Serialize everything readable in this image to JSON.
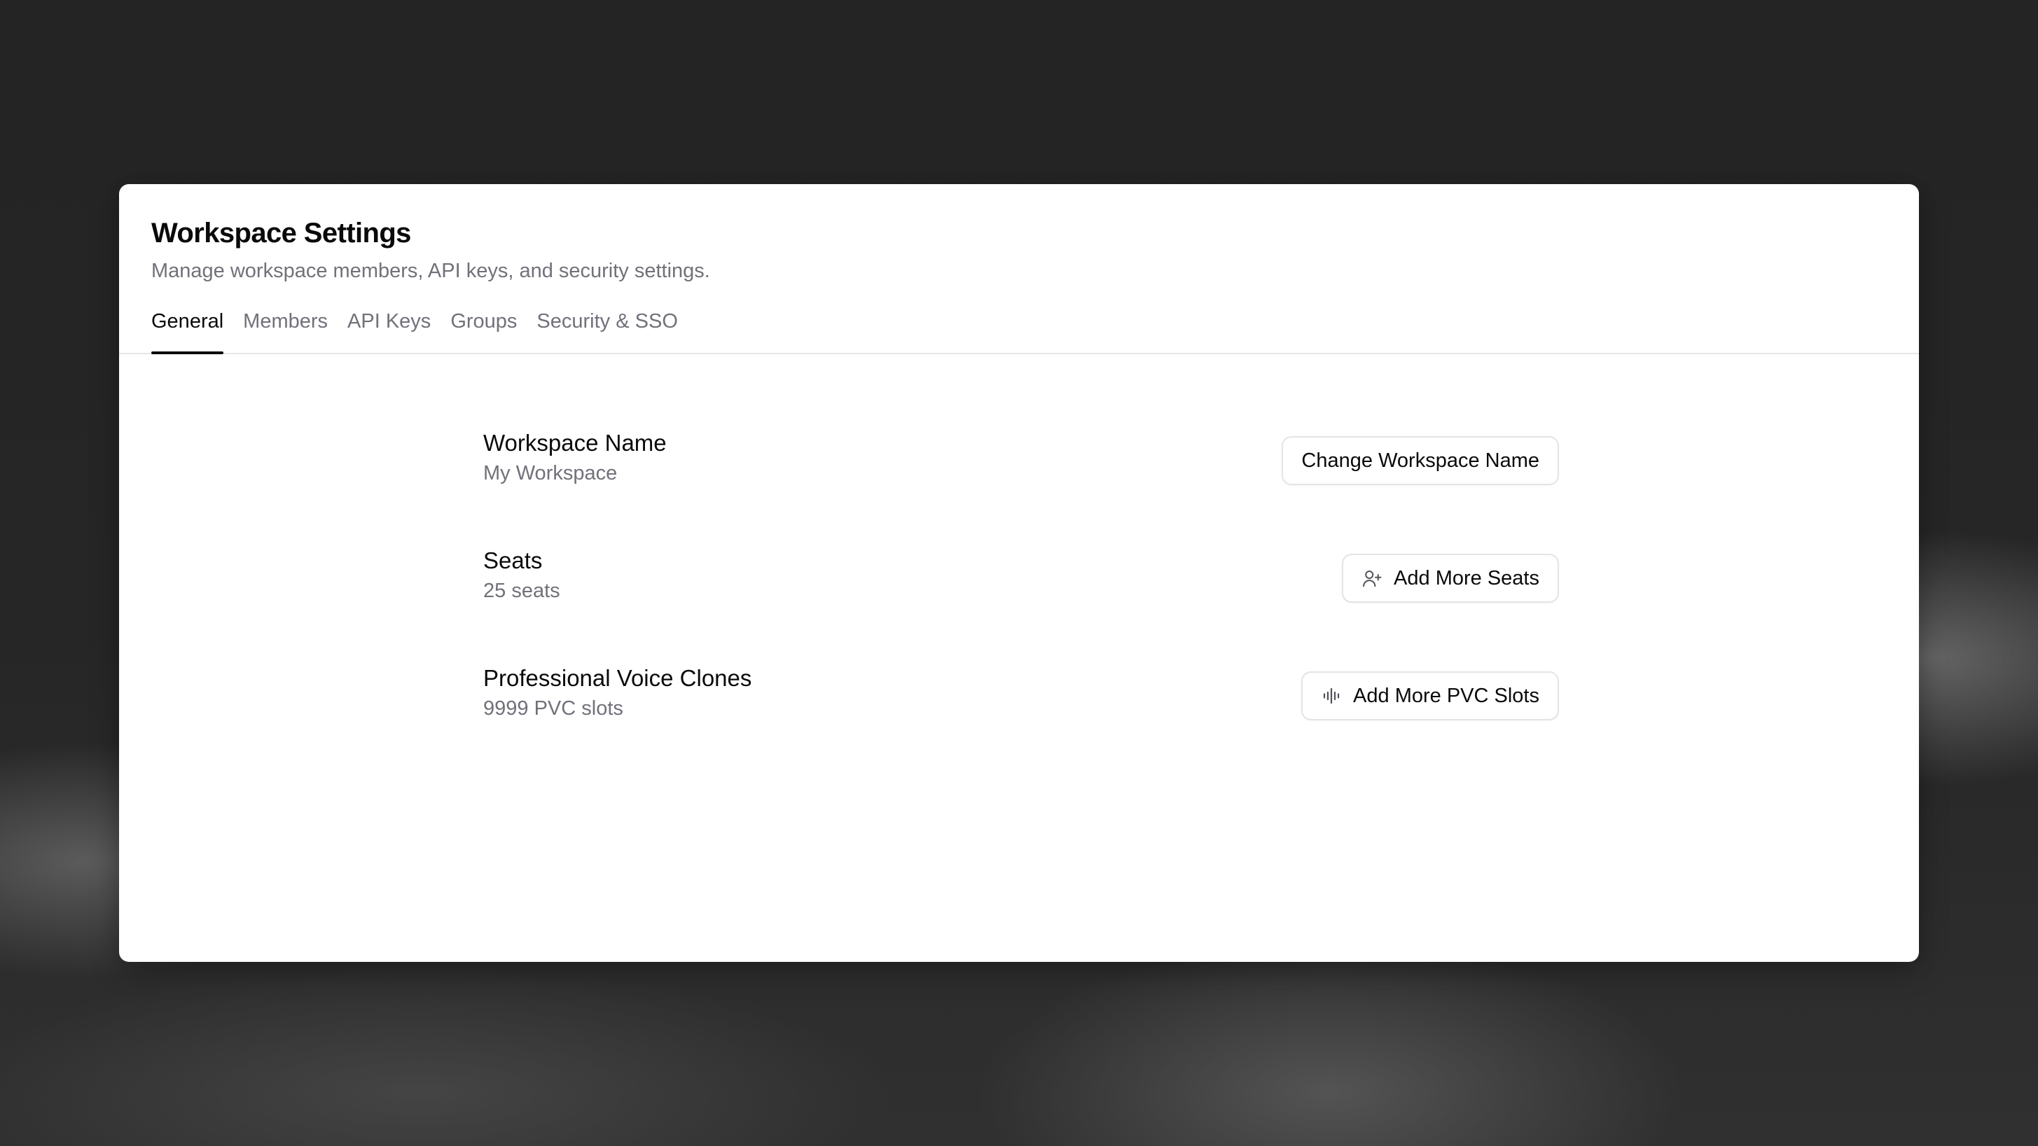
{
  "dialog": {
    "title": "Workspace Settings",
    "subtitle": "Manage workspace members, API keys, and security settings."
  },
  "tabs": [
    {
      "label": "General",
      "active": true
    },
    {
      "label": "Members",
      "active": false
    },
    {
      "label": "API Keys",
      "active": false
    },
    {
      "label": "Groups",
      "active": false
    },
    {
      "label": "Security & SSO",
      "active": false
    }
  ],
  "settings": {
    "workspace_name": {
      "label": "Workspace Name",
      "value": "My Workspace",
      "button_label": "Change Workspace Name"
    },
    "seats": {
      "label": "Seats",
      "value": "25 seats",
      "button_label": "Add More Seats",
      "button_icon": "user-plus-icon"
    },
    "pvc": {
      "label": "Professional Voice Clones",
      "value": "9999 PVC slots",
      "button_label": "Add More PVC Slots",
      "button_icon": "audio-waveform-icon"
    }
  },
  "colors": {
    "primary_text": "#0a0a0a",
    "muted_text": "#71717a",
    "border": "#e4e4e7",
    "backdrop": "#262626"
  }
}
